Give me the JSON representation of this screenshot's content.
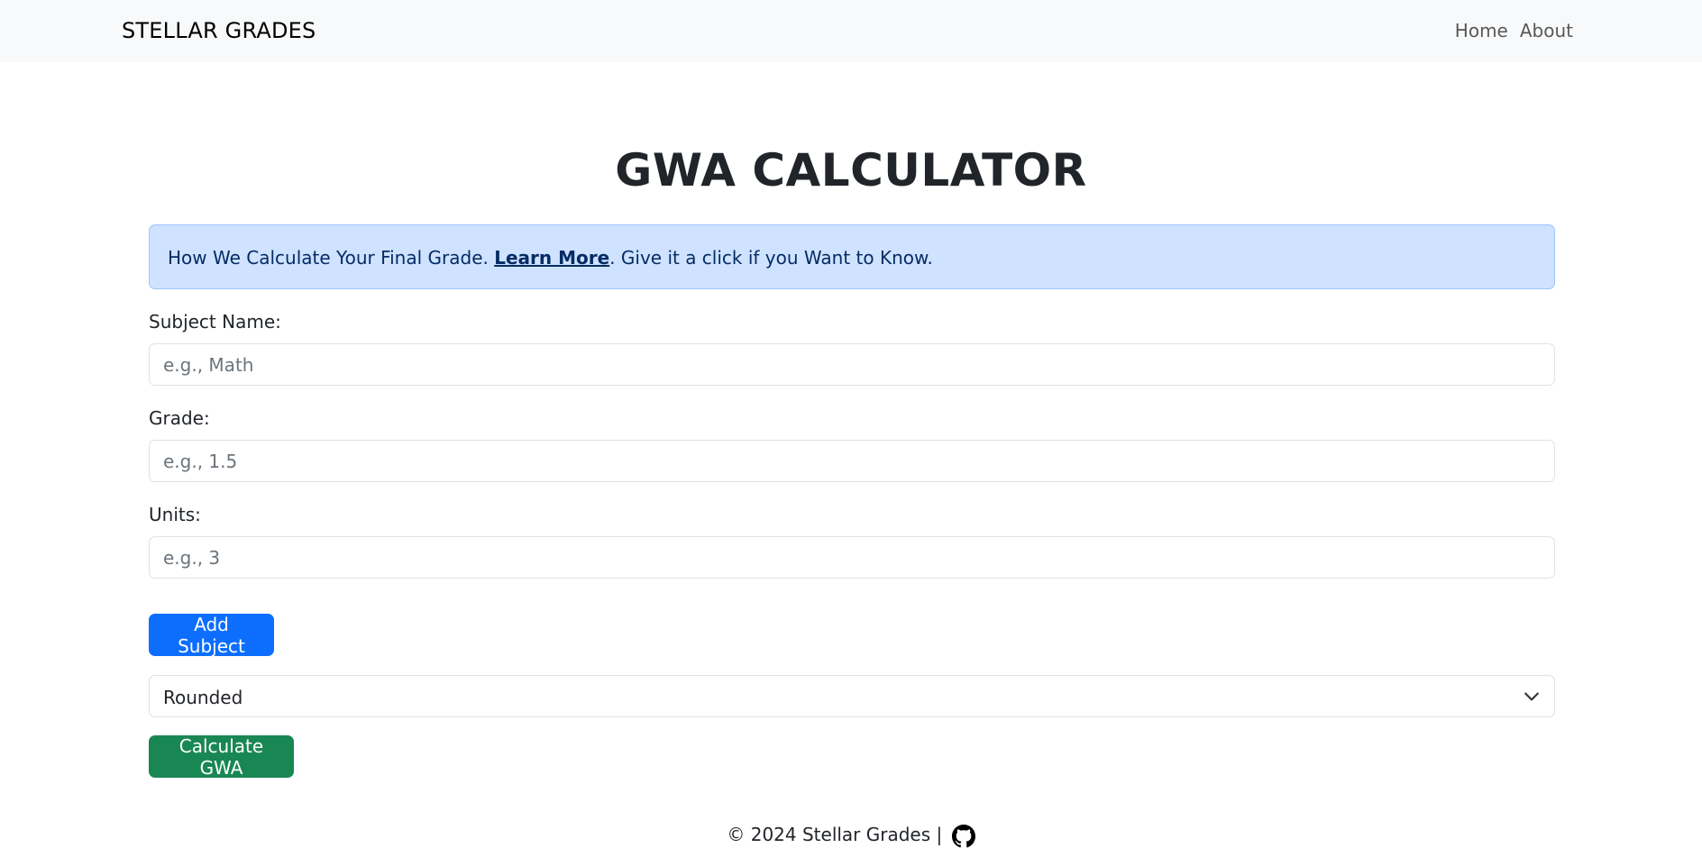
{
  "navbar": {
    "brand": "STELLAR GRADES",
    "links": [
      {
        "label": "Home"
      },
      {
        "label": "About"
      }
    ]
  },
  "main": {
    "title": "GWA CALCULATOR",
    "alert": {
      "prefix": "How We Calculate Your Final Grade. ",
      "link": "Learn More",
      "suffix": ". Give it a click if you Want to Know."
    },
    "form": {
      "subject": {
        "label": "Subject Name:",
        "placeholder": "e.g., Math",
        "value": ""
      },
      "grade": {
        "label": "Grade:",
        "placeholder": "e.g., 1.5",
        "value": ""
      },
      "units": {
        "label": "Units:",
        "placeholder": "e.g., 3",
        "value": ""
      },
      "add_button": "Add Subject",
      "rounding_select": {
        "selected": "Rounded"
      },
      "calculate_button": "Calculate GWA"
    }
  },
  "footer": {
    "text": "© 2024 Stellar Grades | ",
    "icon": "github-icon"
  },
  "colors": {
    "primary": "#0d6efd",
    "success": "#198754",
    "alert_bg": "#cfe2ff",
    "navbar_bg": "#f8f9fa"
  }
}
